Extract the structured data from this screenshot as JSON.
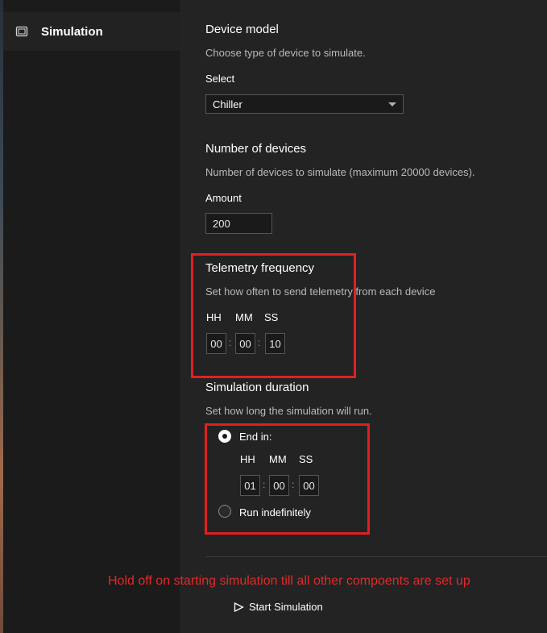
{
  "sidebar": {
    "items": [
      {
        "label": "Simulation",
        "icon": "device-icon"
      }
    ]
  },
  "device_model": {
    "title": "Device model",
    "description": "Choose type of device to simulate.",
    "select_label": "Select",
    "selected": "Chiller"
  },
  "num_devices": {
    "title": "Number of devices",
    "description": "Number of devices to simulate (maximum 20000 devices).",
    "amount_label": "Amount",
    "amount": "200"
  },
  "telemetry": {
    "title": "Telemetry frequency",
    "description": "Set how often to send telemetry from each device",
    "hh_label": "HH",
    "mm_label": "MM",
    "ss_label": "SS",
    "hh": "00",
    "mm": "00",
    "ss": "10",
    "separator": ":"
  },
  "duration": {
    "title": "Simulation duration",
    "description": "Set how long the simulation will run.",
    "end_in_label": "End in:",
    "hh_label": "HH",
    "mm_label": "MM",
    "ss_label": "SS",
    "hh": "01",
    "mm": "00",
    "ss": "00",
    "separator": ":",
    "indefinite_label": "Run indefinitely",
    "selected_option": "End in:"
  },
  "annotation": {
    "note": "Hold off on starting simulation till all other compoents are set up",
    "color": "#e02020"
  },
  "actions": {
    "start_label": "Start Simulation"
  }
}
